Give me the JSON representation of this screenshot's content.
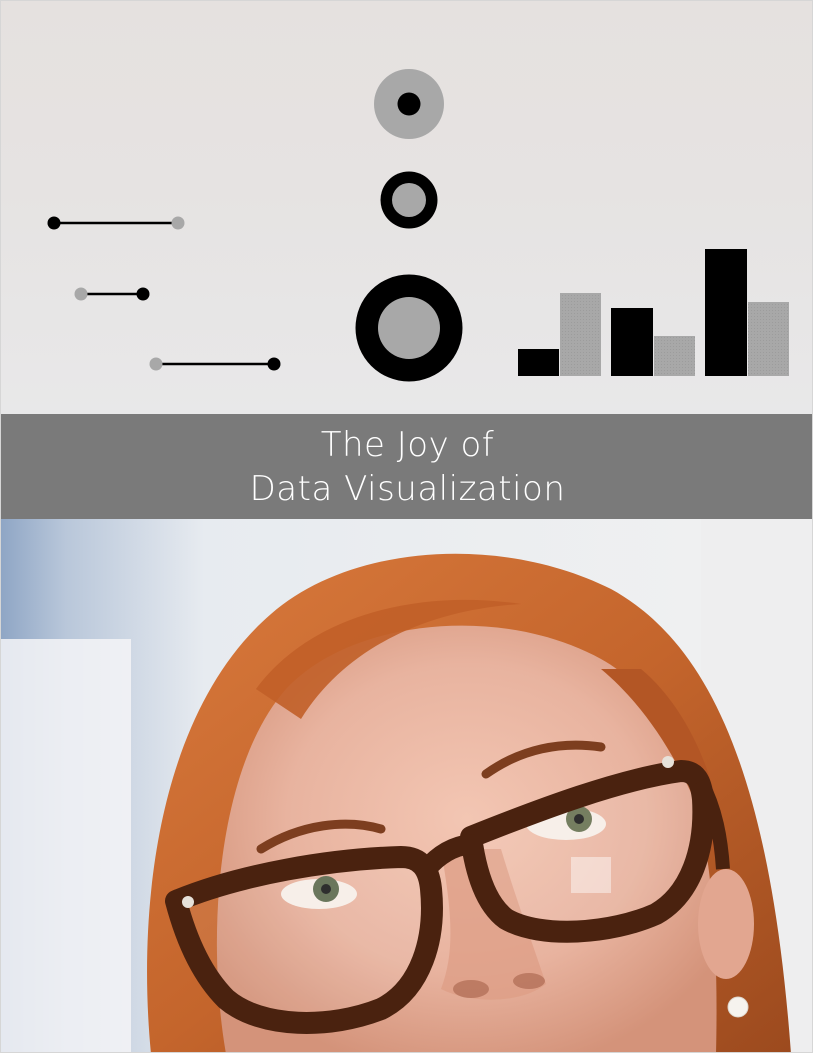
{
  "title": {
    "line1": "The Joy of",
    "line2": "Data Visualization"
  },
  "colors": {
    "background_top": "#e6e3e2",
    "title_band": "#7a7a7a",
    "title_text": "#ffffff",
    "mark_black": "#000000",
    "mark_gray": "#a8a8a8",
    "hair": "#c9652e",
    "glasses": "#4a220f"
  },
  "illustration": {
    "dumbbell_count": 3,
    "ring_count": 3,
    "bar_groups": [
      {
        "black": 2,
        "gray": 6
      },
      {
        "black": 5,
        "gray": 3
      },
      {
        "black": 9.5,
        "gray": 5.5
      }
    ]
  },
  "photo": {
    "icon": "woman-with-glasses-looking-up"
  }
}
